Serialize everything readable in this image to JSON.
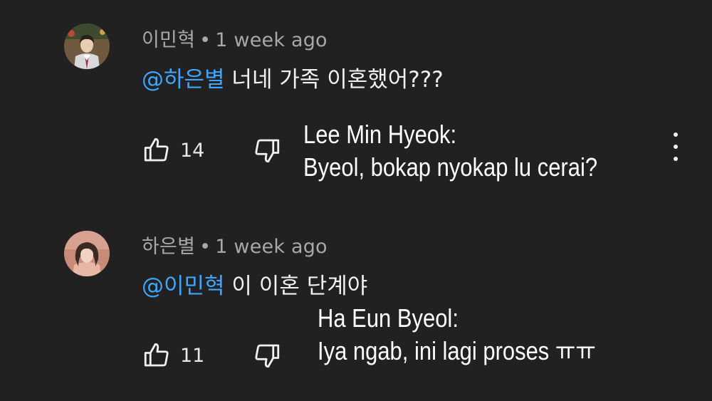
{
  "comments": [
    {
      "author": "이민혁",
      "separator": "•",
      "time": "1 week ago",
      "mention": "@하은별",
      "text": "너네 가족 이혼했어???",
      "likes": "14",
      "translation": {
        "speaker": "Lee Min Hyeok:",
        "line": "Byeol, bokap nyokap lu cerai?"
      },
      "avatar_colors": {
        "bg": "#6f5a3f",
        "face": "#e6cdb4",
        "hair": "#2a2019",
        "shirt": "#d9d9dc",
        "stripe": "#9b2f3a"
      }
    },
    {
      "author": "하은별",
      "separator": "•",
      "time": "1 week ago",
      "mention": "@이민혁",
      "text": "이 이혼 단계야",
      "likes": "11",
      "translation": {
        "speaker": "Ha Eun Byeol:",
        "line": "Iya ngab, ini lagi proses ㅠㅠ"
      },
      "avatar_colors": {
        "bg": "#c98a78",
        "face": "#f1d2c4",
        "hair": "#3a2a22",
        "shirt": "#e9b8a5"
      }
    }
  ],
  "icons": {
    "like": "thumbs-up-icon",
    "dislike": "thumbs-down-icon",
    "more": "more-vert-icon"
  },
  "colors": {
    "background": "#212121",
    "mention": "#3ea6ff",
    "meta_text": "#a8a8a8",
    "body_text": "#f1f1f1"
  }
}
